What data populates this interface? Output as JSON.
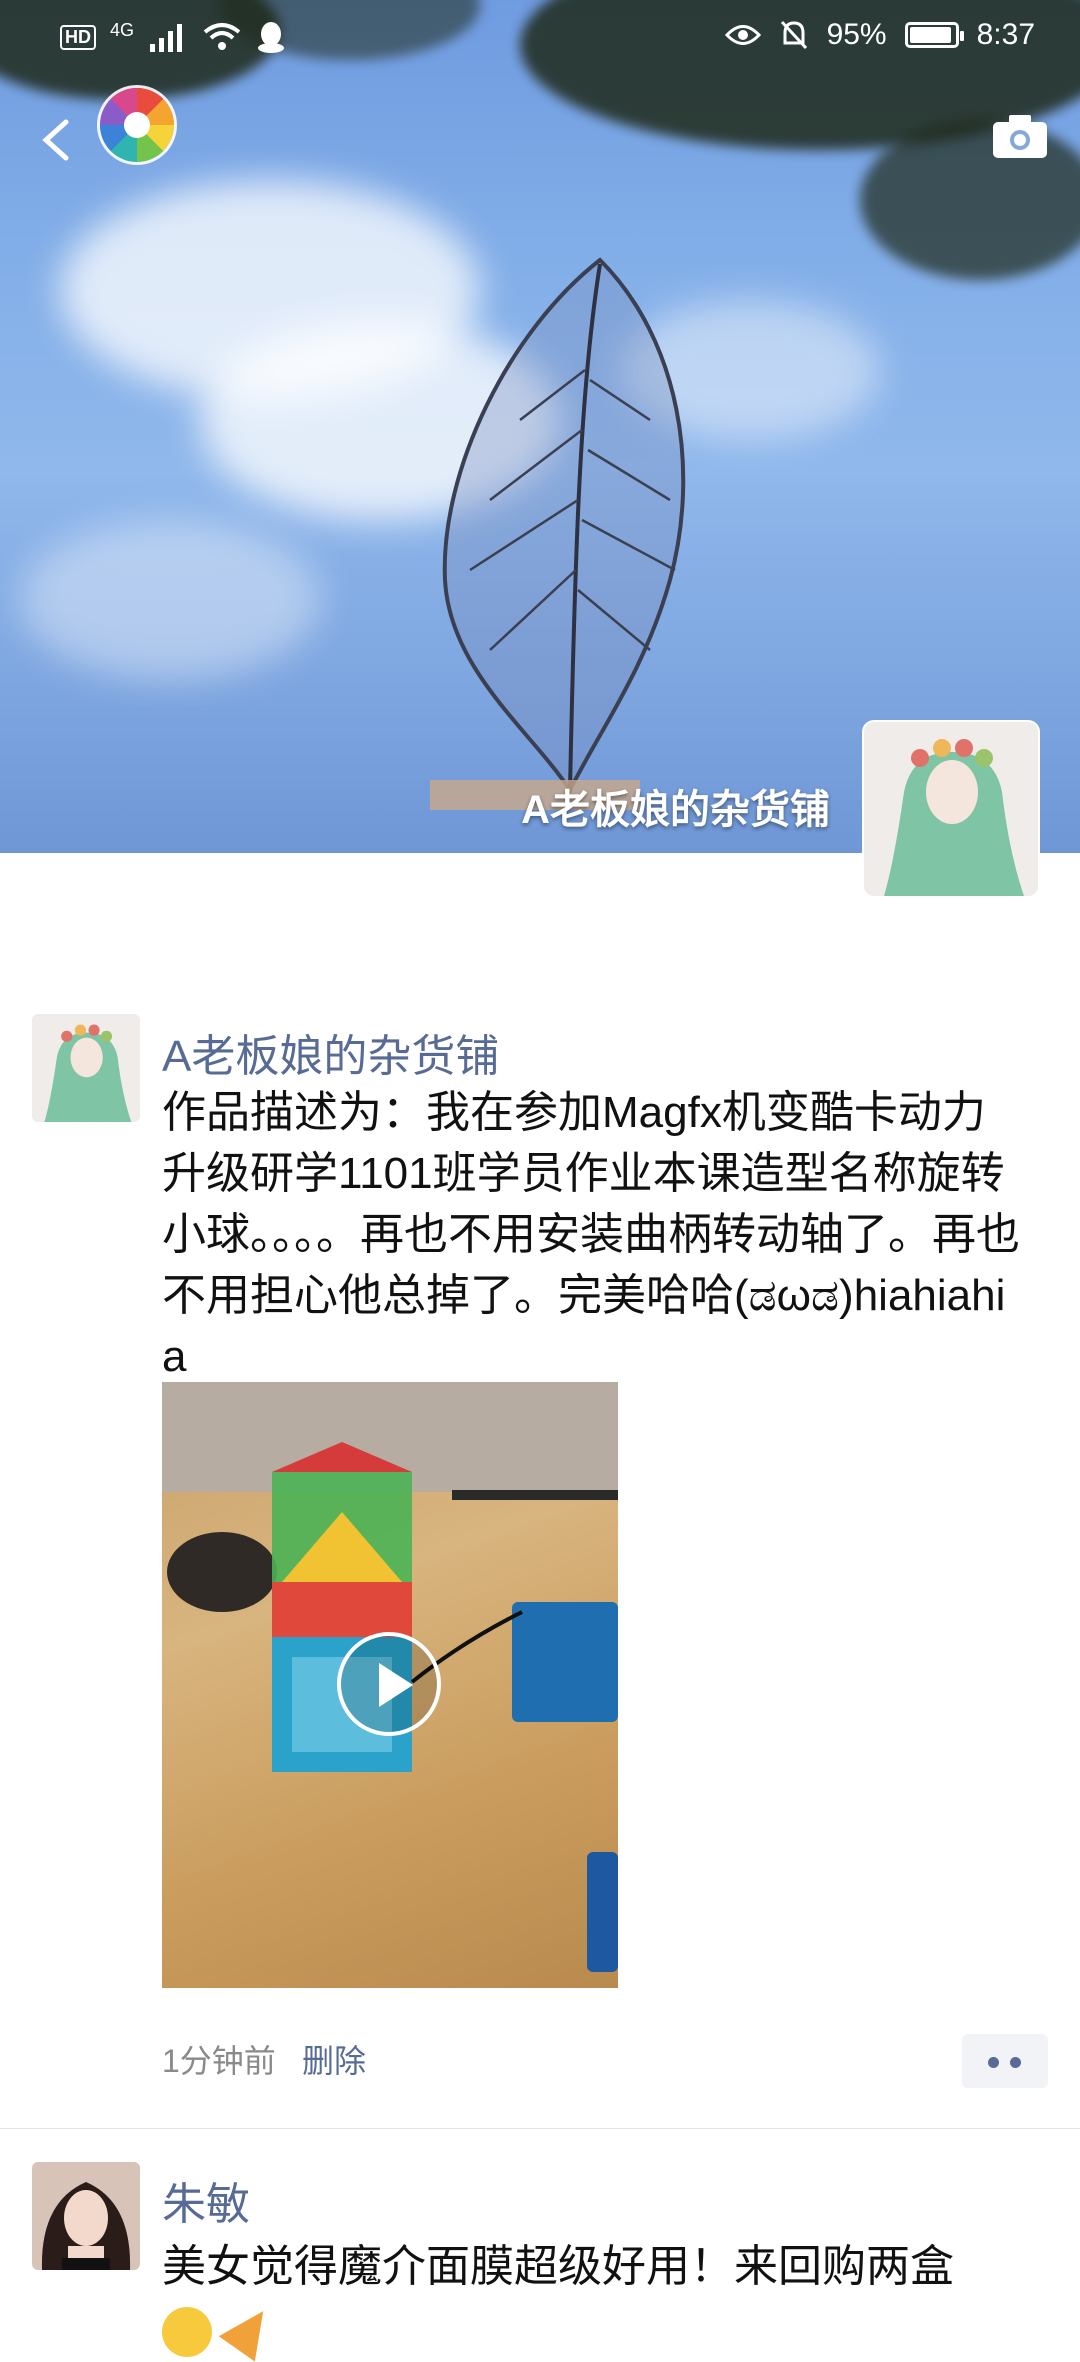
{
  "status_bar": {
    "hd": "HD",
    "network": "4G",
    "battery": "95%",
    "battery_level": 0.95,
    "time": "8:37"
  },
  "header": {
    "icons": {
      "back": "back-arrow-icon",
      "logo": "color-wheel-icon",
      "camera": "camera-icon"
    },
    "profile_name": "A老板娘的杂货铺"
  },
  "posts": [
    {
      "author": "A老板娘的杂货铺",
      "text": "作品描述为：我在参加Magfx机变酷卡动力升级研学1101班学员作业本课造型名称旋转小球。。。。再也不用安装曲柄转动轴了。再也不用担心他总掉了。完美哈哈(ಡωಡ)hiahiahia",
      "time": "1分钟前",
      "delete_label": "删除",
      "media": "video"
    },
    {
      "author": "朱敏",
      "text": "美女觉得魔介面膜超级好用！来回购两盒"
    }
  ],
  "colors": {
    "link": "#576b95",
    "meta": "#8a8a8a",
    "text": "#111111"
  }
}
